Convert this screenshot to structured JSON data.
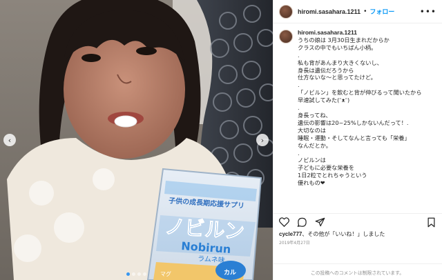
{
  "post": {
    "username": "hiromi.sasahara.1211",
    "follow_label": "フォロー",
    "separator": "•",
    "caption_lines": [
      "うちの娘は 3月30日生まれだからか",
      "クラスの中でもいちばん小柄。",
      ".",
      "私も背があんまり大きくないし、",
      "身長は遺伝だろうから",
      "仕方ないな〜と思ってたけど。",
      ".",
      "「ノビルン」を飲むと背が伸びるって聞いたから",
      "早速試してみた(ᵔᴥᵔ)",
      ".",
      "身長ってね、",
      "遺伝の影響は20~25%しかないんだって！.",
      "大切なのは",
      "睡眠・運動・そしてなんと言っても「栄養」",
      "なんだとか。",
      ".",
      "ノビルンは",
      "子どもに必要な栄養を",
      "1日2粒でとれちゃうという",
      "優れもの❤"
    ],
    "likes_user": "cycle777",
    "likes_text": "、その他が「いいね！」しました",
    "date": "2019年4月27日",
    "comment_notice": "この投稿へのコメントは制限されています。"
  },
  "photo": {
    "package_band": "子供の成長期応援サプリ",
    "package_title": "ノビルン",
    "package_latin": "Nobirun",
    "package_flavor": "ラムネ味",
    "package_corner": "カル",
    "package_side": "マグ",
    "carousel_count": 4,
    "carousel_active": 0
  },
  "icons": [
    "more-icon",
    "heart-icon",
    "comment-icon",
    "share-icon",
    "bookmark-icon",
    "chevron-left-icon",
    "chevron-right-icon"
  ],
  "colors": {
    "link": "#0095f6",
    "muted": "#8e8e8e",
    "border": "#efefef",
    "package_blue": "#2a7fd4"
  }
}
